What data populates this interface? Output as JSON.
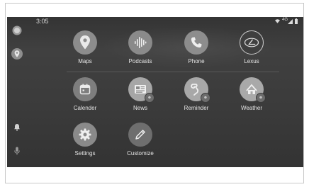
{
  "status_bar": {
    "time": "3:05",
    "network": "4G"
  },
  "rail": {
    "items": [
      {
        "icon": "home-icon"
      },
      {
        "icon": "maps-icon"
      },
      {
        "icon": "notification-bell-icon"
      },
      {
        "icon": "microphone-icon"
      }
    ]
  },
  "apps": {
    "row1": [
      {
        "label": "Maps",
        "icon": "maps-pin-icon"
      },
      {
        "label": "Podcasts",
        "icon": "podcasts-icon"
      },
      {
        "label": "Phone",
        "icon": "phone-icon"
      },
      {
        "label": "Lexus",
        "icon": "lexus-logo-icon"
      }
    ],
    "row2": [
      {
        "label": "Calender",
        "icon": "calendar-icon"
      },
      {
        "label": "News",
        "icon": "news-icon"
      },
      {
        "label": "Reminder",
        "icon": "reminder-icon"
      },
      {
        "label": "Weather",
        "icon": "weather-icon"
      }
    ],
    "row3": [
      {
        "label": "Settings",
        "icon": "settings-gear-icon"
      },
      {
        "label": "Customize",
        "icon": "customize-pencil-icon"
      }
    ]
  },
  "colors": {
    "screen_bg": "#3a3a3a",
    "icon_bg": "#8a8a8a",
    "label_text": "#e6e6e6"
  }
}
